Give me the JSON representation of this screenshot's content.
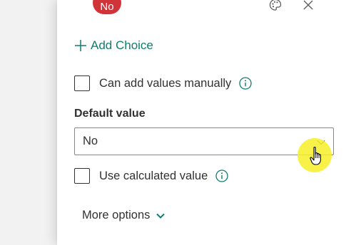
{
  "panel": {
    "choice_chip": {
      "label": "No",
      "color": "#d13438"
    },
    "icons": {
      "palette": "palette-icon",
      "close": "close-icon"
    },
    "add_choice": {
      "label": "Add Choice",
      "icon": "plus-icon",
      "color": "#107c6e"
    },
    "manual_values": {
      "label": "Can add values manually",
      "checked": false,
      "info_icon": "info-icon"
    },
    "default_value": {
      "label": "Default value",
      "selected": "No",
      "chevron": "chevron-down-icon"
    },
    "calculated_value": {
      "label": "Use calculated value",
      "checked": false,
      "info_icon": "info-icon"
    },
    "more_options": {
      "label": "More options",
      "chevron": "chevron-down-icon"
    }
  },
  "cursor": {
    "type": "hand-pointer-icon",
    "highlight_color": "#f7f028"
  }
}
